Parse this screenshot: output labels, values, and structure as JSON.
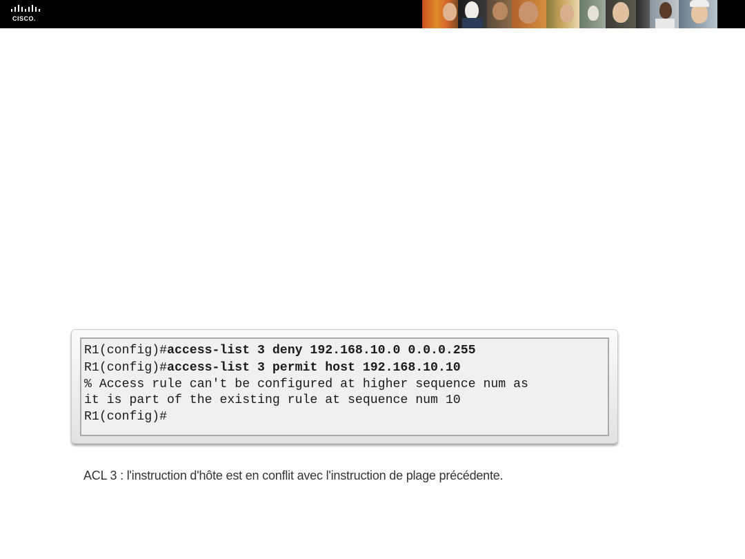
{
  "header": {
    "logo_text": "CISCO.",
    "background": "#000000"
  },
  "terminal": {
    "lines": [
      {
        "prompt": "R1(config)#",
        "command": "access-list 3 deny 192.168.10.0 0.0.0.255"
      },
      {
        "prompt": "R1(config)#",
        "command": "access-list 3 permit host 192.168.10.10"
      },
      {
        "prompt": "",
        "output": "% Access rule can't be configured at higher sequence num as"
      },
      {
        "prompt": "",
        "output": "it is part of the existing rule at sequence num 10"
      },
      {
        "prompt": "R1(config)#",
        "command": ""
      }
    ]
  },
  "caption": "ACL 3 : l'instruction d'hôte est en conflit avec l'instruction de plage précédente."
}
